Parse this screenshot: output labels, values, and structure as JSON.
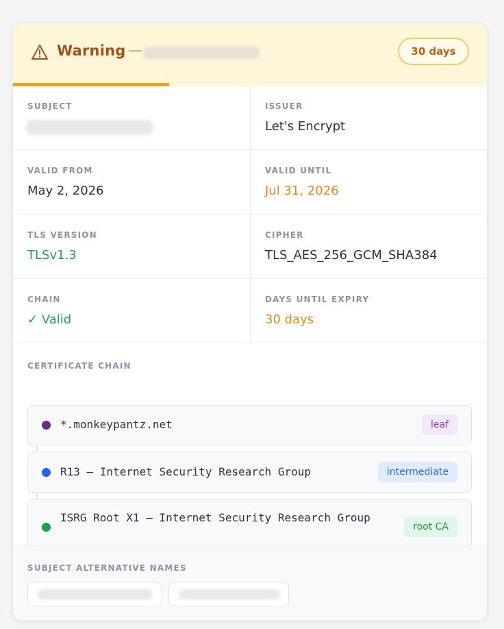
{
  "header": {
    "status_label": "Warning",
    "separator": "—",
    "days_badge": "30 days",
    "icon": "warning-triangle-icon",
    "accent_color": "#a0521a",
    "expiry_progress_percent": 33
  },
  "details": {
    "subject": {
      "label": "SUBJECT"
    },
    "issuer": {
      "label": "ISSUER",
      "value": "Let's Encrypt"
    },
    "valid_from": {
      "label": "VALID FROM",
      "value": "May 2, 2026"
    },
    "valid_until": {
      "label": "VALID UNTIL",
      "value": "Jul 31, 2026"
    },
    "tls_version": {
      "label": "TLS VERSION",
      "value": "TLSv1.3"
    },
    "cipher": {
      "label": "CIPHER",
      "value": "TLS_AES_256_GCM_SHA384"
    },
    "chain": {
      "label": "CHAIN",
      "value": "✓ Valid"
    },
    "days_until_expiry": {
      "label": "DAYS UNTIL EXPIRY",
      "value": "30 days"
    }
  },
  "certificate_chain": {
    "label": "CERTIFICATE CHAIN",
    "items": [
      {
        "name": "*.monkeypantz.net",
        "tag": "leaf",
        "dot_color": "#6a2a86"
      },
      {
        "name": "R13 — Internet Security Research Group",
        "tag": "intermediate",
        "dot_color": "#2563eb"
      },
      {
        "name": "ISRG Root X1 — Internet Security Research Group",
        "tag": "root CA",
        "dot_color": "#16a34a"
      }
    ]
  },
  "san": {
    "label": "SUBJECT ALTERNATIVE NAMES"
  },
  "colors": {
    "green": "#22a05a",
    "orange": "#df8a1e"
  }
}
